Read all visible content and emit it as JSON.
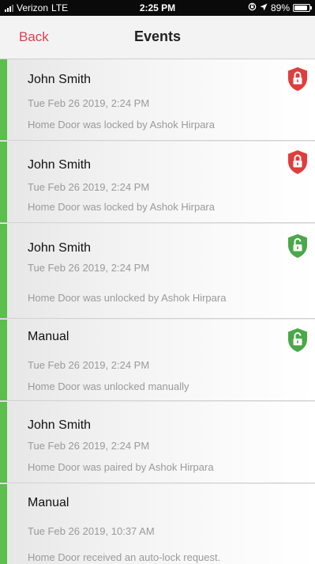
{
  "status_bar": {
    "carrier": "Verizon",
    "network": "LTE",
    "time": "2:25 PM",
    "battery_percent": "89%",
    "battery_level": 0.89
  },
  "nav": {
    "back_label": "Back",
    "title": "Events"
  },
  "colors": {
    "accent_red": "#d9414d",
    "stripe_green": "#5bbf4b",
    "lock_red": "#e03d3d",
    "unlock_green": "#4aa84a"
  },
  "events": [
    {
      "title": "John Smith",
      "date": "Tue Feb 26 2019, 2:24 PM",
      "description": "Home Door was locked by Ashok Hirpara",
      "icon": "locked-shield-icon"
    },
    {
      "title": "John Smith",
      "date": "Tue Feb 26 2019, 2:24 PM",
      "description": "Home Door was locked by Ashok Hirpara",
      "icon": "locked-shield-icon"
    },
    {
      "title": "John Smith",
      "date": "Tue Feb 26 2019, 2:24 PM",
      "description": "Home Door was unlocked by Ashok Hirpara",
      "icon": "unlocked-shield-icon"
    },
    {
      "title": "Manual",
      "date": "Tue Feb 26 2019, 2:24 PM",
      "description": "Home Door was unlocked manually",
      "icon": "unlocked-shield-icon"
    },
    {
      "title": "John Smith",
      "date": "Tue Feb 26 2019, 2:24 PM",
      "description": "Home Door was paired by Ashok Hirpara",
      "icon": ""
    },
    {
      "title": "Manual",
      "date": "Tue Feb 26 2019, 10:37 AM",
      "description": "Home Door received an auto-lock request.",
      "icon": ""
    }
  ]
}
